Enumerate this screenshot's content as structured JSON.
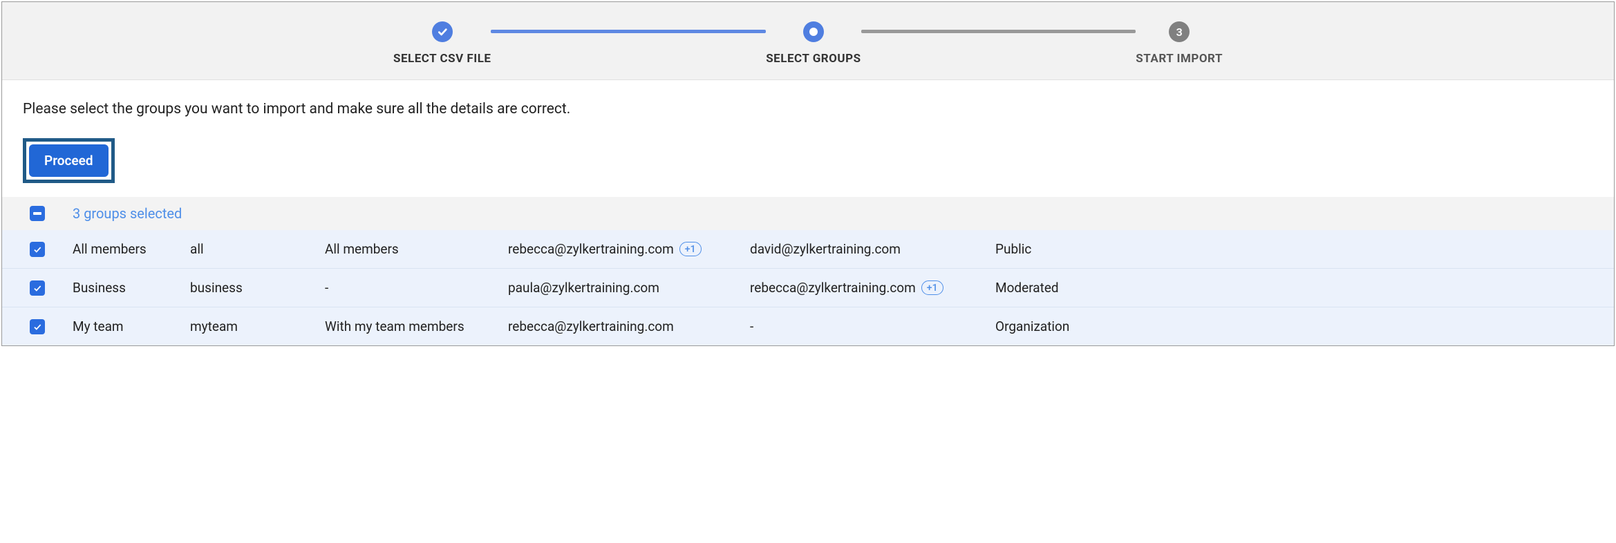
{
  "stepper": {
    "steps": [
      {
        "label": "SELECT CSV FILE",
        "state": "completed"
      },
      {
        "label": "SELECT GROUPS",
        "state": "current"
      },
      {
        "label": "START IMPORT",
        "state": "pending",
        "number": "3"
      }
    ]
  },
  "instruction": "Please select the groups you want to import and make sure all the details are correct.",
  "proceed_label": "Proceed",
  "selection_summary": "3 groups selected",
  "rows": [
    {
      "name": "All members",
      "alias": "all",
      "description": "All members",
      "email1": "rebecca@zylkertraining.com",
      "email1_badge": "+1",
      "email2": "david@zylkertraining.com",
      "email2_badge": "",
      "access": "Public"
    },
    {
      "name": "Business",
      "alias": "business",
      "description": "-",
      "email1": "paula@zylkertraining.com",
      "email1_badge": "",
      "email2": "rebecca@zylkertraining.com",
      "email2_badge": "+1",
      "access": "Moderated"
    },
    {
      "name": "My team",
      "alias": "myteam",
      "description": "With my team members",
      "email1": "rebecca@zylkertraining.com",
      "email1_badge": "",
      "email2": "-",
      "email2_badge": "",
      "access": "Organization"
    }
  ]
}
